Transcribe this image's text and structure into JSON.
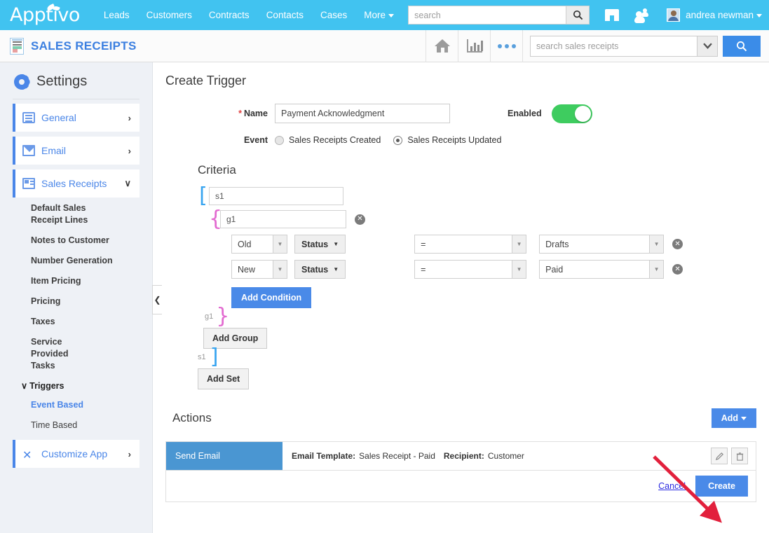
{
  "topnav": {
    "logo": "Apptivo",
    "links": [
      "Leads",
      "Customers",
      "Contracts",
      "Contacts",
      "Cases"
    ],
    "more_label": "More",
    "search_placeholder": "search",
    "search_value": "",
    "username": "andrea newman",
    "icons": [
      "store-icon",
      "people-icon",
      "avatar"
    ]
  },
  "appbar": {
    "title": "SALES RECEIPTS",
    "search_placeholder": "search sales receipts",
    "search_value": "",
    "icons": [
      "home-icon",
      "reports-chart-icon",
      "more-dots-icon",
      "dropdown-caret-icon",
      "search-icon"
    ]
  },
  "sidebar": {
    "heading": "Settings",
    "main_items": [
      {
        "label": "General",
        "icon": "monitor-icon",
        "chevron": "›"
      },
      {
        "label": "Email",
        "icon": "envelope-icon",
        "chevron": "›"
      },
      {
        "label": "Sales Receipts",
        "icon": "receipt-icon",
        "chevron": "∨"
      }
    ],
    "sub_items": [
      "Default Sales Receipt Lines",
      "Notes to Customer",
      "Number Generation",
      "Item Pricing",
      "Pricing",
      "Taxes",
      "Service Provided Tasks"
    ],
    "triggers_label": "Triggers",
    "trigger_items": [
      {
        "label": "Event Based",
        "active": true
      },
      {
        "label": "Time Based",
        "active": false
      }
    ],
    "customize_app": {
      "label": "Customize App",
      "icon": "tools-icon",
      "chevron": "›"
    },
    "collapse_icon": "chevron-left-icon"
  },
  "form": {
    "page_title": "Create Trigger",
    "name_label": "Name",
    "name_required_marker": "*",
    "name_value": "Payment Acknowledgment",
    "enabled_label": "Enabled",
    "enabled_state": "on",
    "event_label": "Event",
    "event_options": [
      {
        "label": "Sales Receipts Created",
        "selected": false
      },
      {
        "label": "Sales Receipts Updated",
        "selected": true
      }
    ]
  },
  "criteria": {
    "title": "Criteria",
    "set": {
      "open_bracket": "[",
      "close_bracket": "]",
      "name": "s1",
      "tag": "s1"
    },
    "group": {
      "open_brace": "{",
      "close_brace": "}",
      "name": "g1",
      "tag": "g1",
      "remove_icon": "remove-icon"
    },
    "conditions": [
      {
        "field_scope": "Old",
        "field": "Status",
        "operator": "=",
        "value": "Drafts",
        "remove_icon": "remove-icon"
      },
      {
        "field_scope": "New",
        "field": "Status",
        "operator": "=",
        "value": "Paid",
        "remove_icon": "remove-icon"
      }
    ],
    "add_condition_label": "Add Condition",
    "add_group_label": "Add Group",
    "add_set_label": "Add Set"
  },
  "actions": {
    "title": "Actions",
    "add_label": "Add",
    "rows": [
      {
        "type": "Send Email",
        "field1_label": "Email Template:",
        "field1_value": "Sales Receipt - Paid",
        "field2_label": "Recipient:",
        "field2_value": "Customer",
        "edit_icon": "pencil-icon",
        "delete_icon": "trash-icon"
      }
    ],
    "cancel_label": "Cancel",
    "create_label": "Create"
  },
  "colors": {
    "brand_blue": "#41c3f0",
    "link_blue": "#4a86e8",
    "button_blue": "#4a8ae8",
    "toggle_green": "#3ecc5f",
    "action_blue": "#4a96d2",
    "annotation_red": "#e2203c",
    "bracket_blue": "#39a5f0",
    "brace_pink": "#e26ad0"
  },
  "annotation": {
    "shape": "red-arrow",
    "points_to": "create-button"
  }
}
